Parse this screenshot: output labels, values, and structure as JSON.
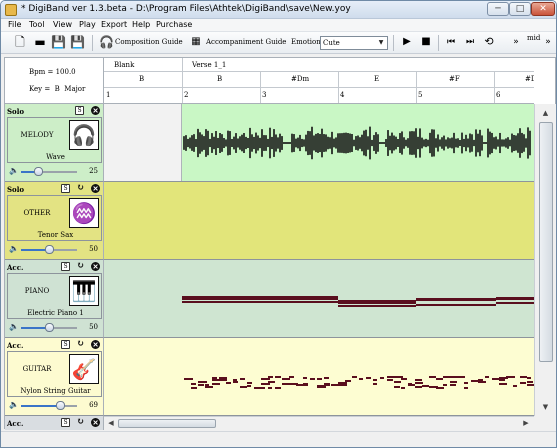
{
  "window": {
    "title": "* DigiBand ver 1.3.beta  -  D:\\Program Files\\Athtek\\DigiBand\\save\\New.yoy",
    "min": "─",
    "max": "□",
    "close": "✕"
  },
  "menu": [
    "File",
    "Tool",
    "View",
    "Play",
    "Export",
    "Help",
    "Purchase"
  ],
  "toolbar": {
    "composition_guide": "Composition Guide",
    "accompaniment_guide": "Accompaniment Guide",
    "emotion_label": "Emotion",
    "emotion_value": "Cute",
    "midi_label": "mid"
  },
  "song": {
    "bpm": "Bpm = 100.0",
    "key": "Key =  B  Major"
  },
  "timeline": {
    "sections": [
      "Blank",
      "Verse 1_1"
    ],
    "chords": [
      "B",
      "B",
      "#Dm",
      "E",
      "#F",
      "#Dm"
    ],
    "bars": [
      "1",
      "2",
      "3",
      "4",
      "5",
      "6"
    ]
  },
  "tracks": [
    {
      "kind": "Solo",
      "name": "MELODY",
      "instrument": "Wave",
      "volume": "25",
      "volume_fraction": 0.3,
      "color": "#cdeec8",
      "content_color": "#c9f7c5",
      "icon": "headset-microphone-icon",
      "symbol": "🎧",
      "second_button": "S"
    },
    {
      "kind": "Solo",
      "name": "OTHER",
      "instrument": "Tenor Sax",
      "volume": "50",
      "volume_fraction": 0.5,
      "color": "#e3e383",
      "content_color": "#e2e57a",
      "icon": "lyre-icon",
      "symbol": "♒",
      "second_button": "↻"
    },
    {
      "kind": "Acc.",
      "name": "PIANO",
      "instrument": "Electric Piano 1",
      "volume": "50",
      "volume_fraction": 0.5,
      "color": "#cfe2d3",
      "content_color": "#cfe5d1",
      "icon": "piano-icon",
      "symbol": "🎹",
      "second_button": "↻"
    },
    {
      "kind": "Acc.",
      "name": "GUITAR",
      "instrument": "Nylon String Guitar",
      "volume": "69",
      "volume_fraction": 0.69,
      "color": "#fdfbd0",
      "content_color": "#fdfdd2",
      "icon": "guitar-icon",
      "symbol": "🎸",
      "second_button": "↻"
    },
    {
      "kind": "Acc.",
      "name": "",
      "instrument": "",
      "volume": "",
      "volume_fraction": 0,
      "color": "#d9dde1",
      "content_color": "#ffffff",
      "icon": "",
      "symbol": "",
      "second_button": "↻"
    }
  ],
  "colors": {
    "waveform": "#111111",
    "note": "#5a0f1e",
    "blank_region": "#f2f2f2"
  }
}
